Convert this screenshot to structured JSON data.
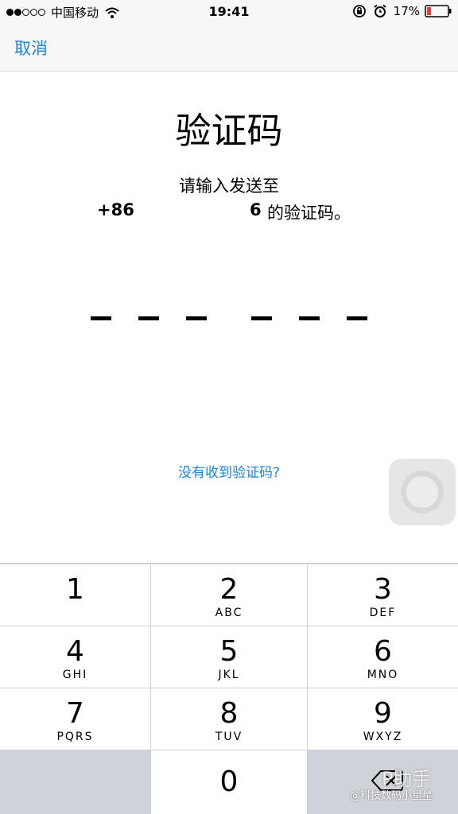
{
  "status_bar": {
    "signal": [
      "full",
      "full",
      "empty",
      "empty",
      "empty"
    ],
    "carrier": "中国移动",
    "time": "19:41",
    "battery_percent": "17%",
    "icons": [
      "wifi-icon",
      "rotation-lock-icon",
      "alarm-icon",
      "battery-icon"
    ],
    "battery_color": "#ff3b30"
  },
  "nav": {
    "cancel_label": "取消"
  },
  "main": {
    "title": "验证码",
    "prompt_line1": "请输入发送至",
    "country_code": "+86",
    "phone_tail": "6",
    "prompt_suffix": "的验证码。",
    "code_slots_count": 6,
    "resend_label": "没有收到验证码?"
  },
  "keypad": {
    "keys": [
      {
        "num": "1",
        "letters": ""
      },
      {
        "num": "2",
        "letters": "ABC"
      },
      {
        "num": "3",
        "letters": "DEF"
      },
      {
        "num": "4",
        "letters": "GHI"
      },
      {
        "num": "5",
        "letters": "JKL"
      },
      {
        "num": "6",
        "letters": "MNO"
      },
      {
        "num": "7",
        "letters": "PQRS"
      },
      {
        "num": "8",
        "letters": "TUV"
      },
      {
        "num": "9",
        "letters": "WXYZ"
      },
      {
        "num": "0",
        "letters": ""
      }
    ]
  },
  "watermark": {
    "logo_text": "P助手",
    "text": "@科技数码小星星"
  },
  "colors": {
    "accent": "#1a82e5",
    "keypad_bg": "#cfd3d9",
    "nav_bg": "#f7f7f7"
  }
}
